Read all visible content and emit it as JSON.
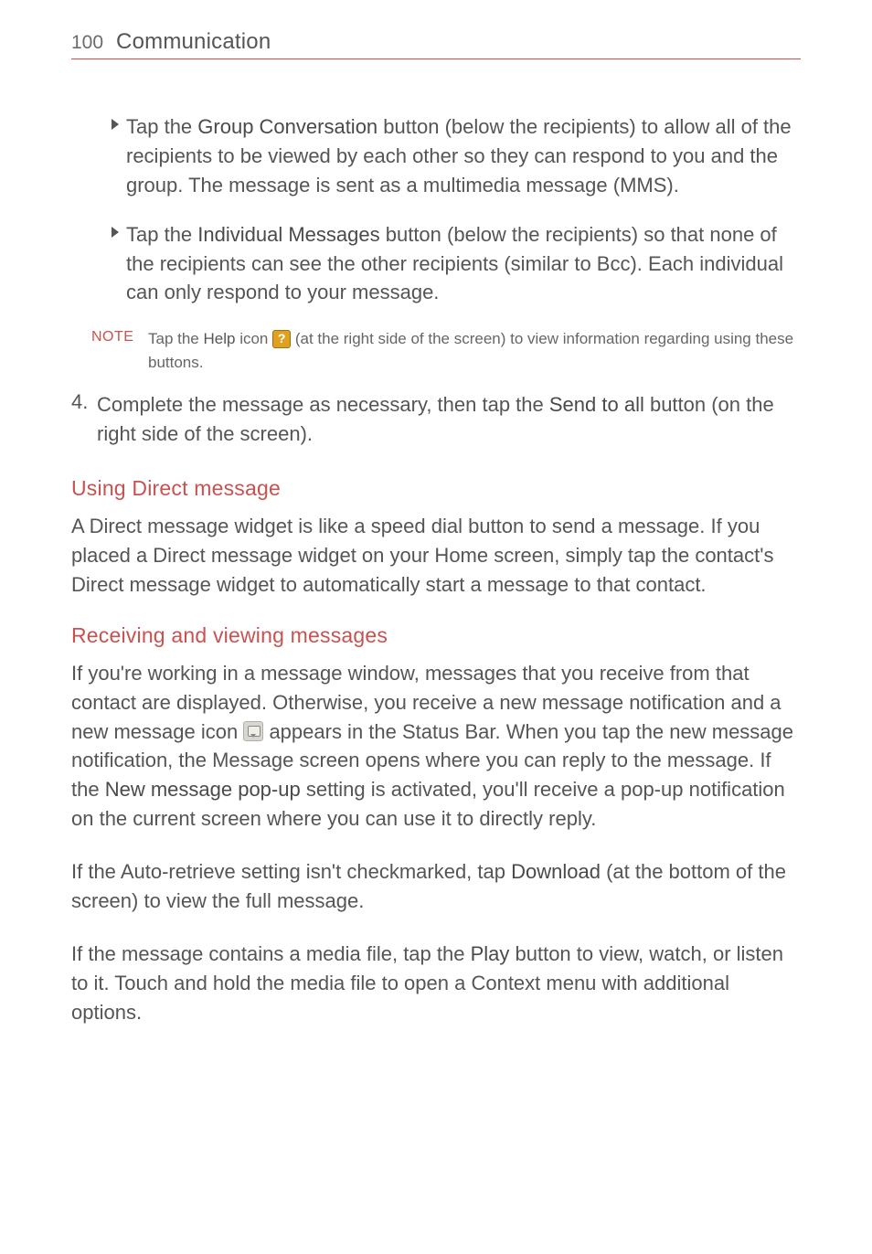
{
  "header": {
    "page_number": "100",
    "chapter": "Communication"
  },
  "bullets": [
    {
      "pre": "Tap the ",
      "bold": "Group Conversation",
      "post": " button (below the recipients) to allow all of the recipients to be viewed by each other so they can respond to you and the group. The message is sent as a multimedia message (MMS)."
    },
    {
      "pre": "Tap the ",
      "bold": "Individual Messages",
      "post": " button (below the recipients) so that none of the recipients can see the other recipients (similar to Bcc). Each individual can only respond to your message."
    }
  ],
  "note": {
    "label": "NOTE",
    "pre": "Tap the ",
    "bold": "Help",
    "mid": " icon ",
    "post": " (at the right side of the screen) to view information regarding using these buttons."
  },
  "step4": {
    "num": "4.",
    "pre": "Complete the message as necessary, then tap the ",
    "bold": "Send to all",
    "post": " button (on the right side of the screen)."
  },
  "section_direct": {
    "title": "Using Direct message",
    "body": "A Direct message widget is like a speed dial button to send a message. If you placed a Direct message widget on your Home screen, simply tap the contact's Direct message widget to automatically start a message to that contact."
  },
  "section_recv": {
    "title": "Receiving and viewing messages",
    "p1_pre": "If you're working in a message window, messages that you receive from that contact are displayed. Otherwise, you receive a new message notification and a new message icon ",
    "p1_mid": " appears in the Status Bar. When you tap the new message notification, the Message screen opens where you can reply to the message. If the ",
    "p1_bold": "New message pop-up",
    "p1_post": " setting is activated, you'll receive a pop-up notification on the current screen where you can use it to directly reply.",
    "p2_pre": "If the Auto-retrieve setting isn't checkmarked, tap ",
    "p2_bold": "Download",
    "p2_post": " (at the bottom of the screen) to view the full message.",
    "p3_pre": "If the message contains a media file, tap the ",
    "p3_bold": "Play",
    "p3_post": " button to view, watch, or listen to it. Touch and hold the media file to open a Context menu with additional options."
  }
}
